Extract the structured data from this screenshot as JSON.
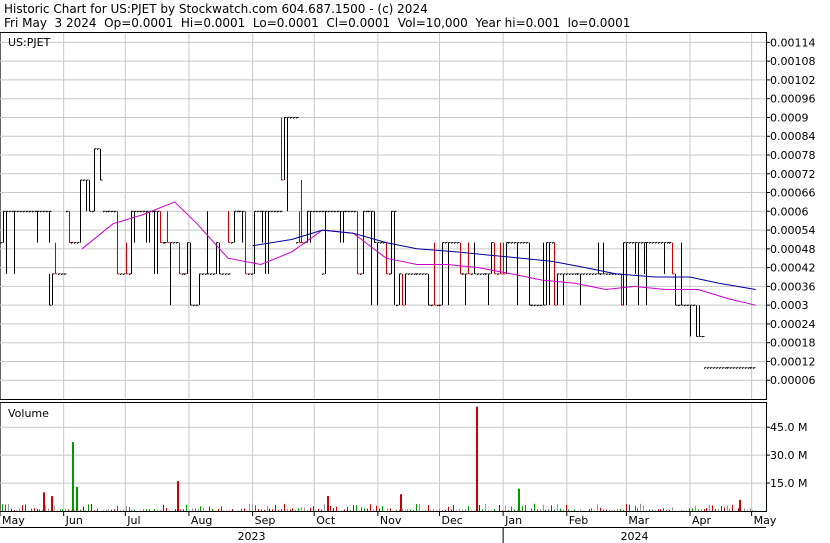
{
  "header": {
    "line1": "Historic Chart for US:PJET by Stockwatch.com 604.687.1500 - (c) 2024",
    "line2": "Fri May  3 2024  Op=0.0001  Hi=0.0001  Lo=0.0001  Cl=0.0001  Vol=10,000  Year hi=0.001  lo=0.0001"
  },
  "colors": {
    "price_bar": "#000000",
    "price_down": "#cc0000",
    "ma_short": "#cc00cc",
    "ma_long": "#000099",
    "volume_up": "#009900",
    "volume_down": "#cc0000",
    "volume_flat": "#999999",
    "grid": "#c8c8c8"
  },
  "chart_data": [
    {
      "type": "bar",
      "subtype": "ohlc-price",
      "ticker_label": "US:PJET",
      "y_ticks": [
        "0.00114",
        "0.00108",
        "0.00102",
        "0.00096",
        "0.0009",
        "0.00084",
        "0.00078",
        "0.00072",
        "0.00066",
        "0.0006",
        "0.00054",
        "0.00048",
        "0.00042",
        "0.00036",
        "0.0003",
        "0.00024",
        "0.00018",
        "0.00012",
        "0.00006"
      ],
      "ylim": [
        0,
        0.00117
      ],
      "grid": true,
      "x_months": [
        "May",
        "Jun",
        "Jul",
        "Aug",
        "Sep",
        "Oct",
        "Nov",
        "Dec",
        "Jan",
        "Feb",
        "Mar",
        "Apr",
        "May"
      ],
      "x_years": [
        "2023",
        "2024"
      ],
      "price_segments": [
        {
          "from": "2023-05-01",
          "to": "2023-05-25",
          "low": 0.0004,
          "high": 0.0006
        },
        {
          "from": "2023-05-25",
          "to": "2023-06-02",
          "low": 0.0003,
          "high": 0.0006
        },
        {
          "from": "2023-06-02",
          "to": "2023-06-20",
          "low": 0.0005,
          "high": 0.0008
        },
        {
          "from": "2023-06-20",
          "to": "2023-07-20",
          "low": 0.0004,
          "high": 0.00065
        },
        {
          "from": "2023-07-20",
          "to": "2023-08-20",
          "low": 0.0003,
          "high": 0.0006
        },
        {
          "from": "2023-08-20",
          "to": "2023-09-15",
          "low": 0.0004,
          "high": 0.0006
        },
        {
          "from": "2023-09-15",
          "to": "2023-09-22",
          "low": 0.0006,
          "high": 0.001
        },
        {
          "from": "2023-09-22",
          "to": "2023-10-05",
          "low": 0.0005,
          "high": 0.0007
        },
        {
          "from": "2023-10-05",
          "to": "2023-11-10",
          "low": 0.0003,
          "high": 0.0006
        },
        {
          "from": "2023-11-10",
          "to": "2024-03-31",
          "low": 0.0003,
          "high": 0.0005
        },
        {
          "from": "2024-04-01",
          "to": "2024-04-08",
          "low": 0.0001,
          "high": 0.0003
        },
        {
          "from": "2024-04-08",
          "to": "2024-05-03",
          "low": 0.0001,
          "high": 0.0001
        }
      ],
      "moving_averages": [
        {
          "color_key": "ma_short",
          "points": [
            [
              "2023-06-10",
              0.00048
            ],
            [
              "2023-06-25",
              0.00056
            ],
            [
              "2023-07-10",
              0.00059
            ],
            [
              "2023-07-25",
              0.00063
            ],
            [
              "2023-08-05",
              0.00056
            ],
            [
              "2023-08-20",
              0.00045
            ],
            [
              "2023-09-05",
              0.00043
            ],
            [
              "2023-09-20",
              0.00047
            ],
            [
              "2023-10-05",
              0.00054
            ],
            [
              "2023-10-20",
              0.00053
            ],
            [
              "2023-11-05",
              0.00045
            ],
            [
              "2023-11-20",
              0.00043
            ],
            [
              "2023-12-05",
              0.00043
            ],
            [
              "2023-12-20",
              0.00042
            ],
            [
              "2024-01-05",
              0.0004
            ],
            [
              "2024-01-20",
              0.00038
            ],
            [
              "2024-02-05",
              0.00037
            ],
            [
              "2024-02-20",
              0.00035
            ],
            [
              "2024-03-05",
              0.00036
            ],
            [
              "2024-03-20",
              0.00035
            ],
            [
              "2024-04-05",
              0.00035
            ],
            [
              "2024-04-20",
              0.00032
            ],
            [
              "2024-05-03",
              0.0003
            ]
          ]
        },
        {
          "color_key": "ma_long",
          "points": [
            [
              "2023-09-01",
              0.00049
            ],
            [
              "2023-09-20",
              0.00051
            ],
            [
              "2023-10-05",
              0.00054
            ],
            [
              "2023-10-20",
              0.00053
            ],
            [
              "2023-11-05",
              0.0005
            ],
            [
              "2023-11-20",
              0.00048
            ],
            [
              "2023-12-10",
              0.00047
            ],
            [
              "2023-12-25",
              0.00046
            ],
            [
              "2024-01-10",
              0.00045
            ],
            [
              "2024-01-25",
              0.00044
            ],
            [
              "2024-02-10",
              0.00042
            ],
            [
              "2024-02-25",
              0.0004
            ],
            [
              "2024-03-15",
              0.00039
            ],
            [
              "2024-04-01",
              0.00039
            ],
            [
              "2024-04-15",
              0.00037
            ],
            [
              "2024-05-03",
              0.00035
            ]
          ]
        }
      ]
    },
    {
      "type": "bar",
      "subtype": "volume",
      "label": "Volume",
      "y_ticks": [
        "45.0 M",
        "30.0 M",
        "15.0 M"
      ],
      "ylim": [
        0,
        58
      ],
      "unit": "M",
      "grid": true,
      "highlights": [
        {
          "date": "2023-06-05",
          "value": 37,
          "color_key": "volume_up"
        },
        {
          "date": "2023-06-07",
          "value": 13,
          "color_key": "volume_up"
        },
        {
          "date": "2023-07-26",
          "value": 16,
          "color_key": "volume_down"
        },
        {
          "date": "2023-05-22",
          "value": 10,
          "color_key": "volume_down"
        },
        {
          "date": "2023-05-26",
          "value": 8,
          "color_key": "volume_down"
        },
        {
          "date": "2023-10-07",
          "value": 8,
          "color_key": "volume_down"
        },
        {
          "date": "2023-11-12",
          "value": 9,
          "color_key": "volume_down"
        },
        {
          "date": "2023-12-19",
          "value": 56,
          "color_key": "volume_down"
        },
        {
          "date": "2024-01-08",
          "value": 12,
          "color_key": "volume_up"
        },
        {
          "date": "2024-04-25",
          "value": 6,
          "color_key": "volume_down"
        }
      ]
    }
  ]
}
